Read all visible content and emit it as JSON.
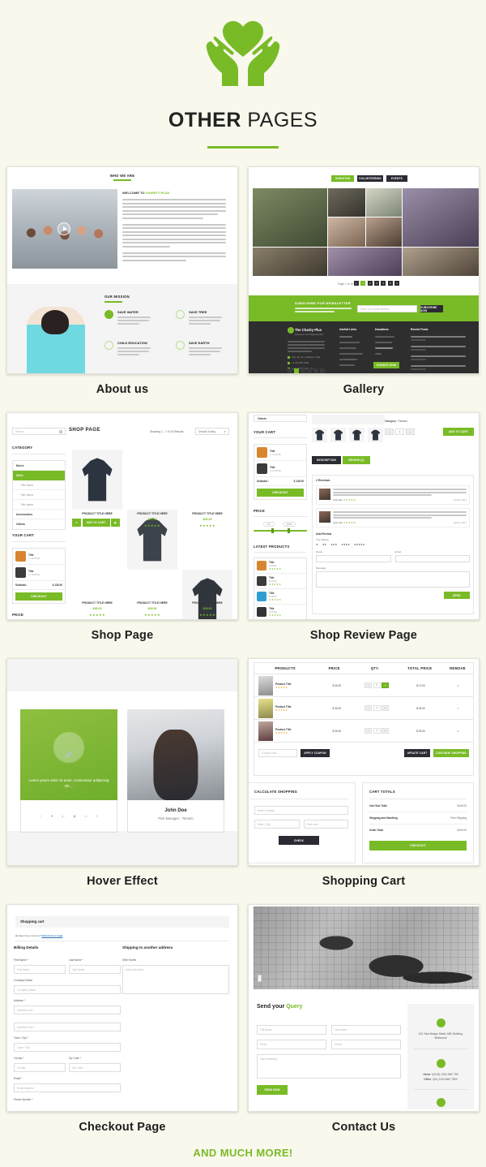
{
  "header": {
    "logo_icon": "heart-in-hands-icon",
    "title_bold": "OTHER",
    "title_light": " PAGES",
    "accent_color": "#79bb27",
    "background_color": "#f9f8ec"
  },
  "footer_note": "AND MUCH MORE!",
  "pages": [
    {
      "id": "about-us",
      "caption": "About us",
      "content": {
        "section1_title": "WHO WE ARE",
        "welcome_prefix": "WELCOME TO ",
        "welcome_brand": "CHARITY PLUS",
        "paragraphs": [
          "Aliquam volutpat malesuada aliquet. Cras sit amet dolor maximus, auctor augue eu, vulputate massa. Praesent ut ligula quis tellus ultrices consequat ut et magna. Nunc imperdiet arcu non dui semper, a elementum nisi pharetra. Donec nec eros eu odio venenatis maximus eros at felis rutrum, a rhoncus est venenatis.",
          "Vivamus ultrices rhoncus ex eget cursus magna pharetra at. Proin molestie mattis mauris, sed vulputate odio facilisis sed. Cras congue odio at ornare pulvinar tempus. Duis malesuada dui vitae tellus mollis vehicula. Sed aliquam molestie libero eget auctor. Integer ut mauris at enim sodales iaculis. Cras tincidunt facilisis lectus eget vulputate. Vestibulum cursus euismod posuere. Mauris sed ornare augue, quis accumsan lacus.",
          "Praesent ullamcorper semper arcu, non tincidunt sapien varius a, vestibulum varius libero nibh, pretium tempor lacus auctor quis. Sed pharetra faucibus ultrices."
        ],
        "section2_title": "OUR MISSION",
        "features": [
          {
            "icon": "water-drop-icon",
            "title": "SAVE WATER",
            "text": "Vestibulum in erat nec ante interdum viverra a a Sed hendrerit, metus"
          },
          {
            "icon": "tree-icon",
            "title": "SAVE TREE",
            "text": "Vestibulum in erat nec ante interdum viverra a a Sed hendrerit, metus"
          },
          {
            "icon": "education-icon",
            "title": "CHILD EDUCATION",
            "text": "Vestibulum in erat nec ante interdum viverra a a Sed hendrerit, metus"
          },
          {
            "icon": "recycle-earth-icon",
            "title": "SAVE EARTH",
            "text": "Vestibulum in erat nec ante interdum viverra a a Sed hendrerit, metus"
          }
        ],
        "play_icon": "play-button-icon"
      }
    },
    {
      "id": "gallery",
      "caption": "Gallery",
      "content": {
        "filters": [
          "DONATION",
          "VOLUNTEERING",
          "EVENTS"
        ],
        "active_filter": "DONATION",
        "pager_label": "Page 1 to 10",
        "pager_items": [
          "«",
          "1",
          "2",
          "3",
          "4",
          "5",
          "6",
          "»"
        ],
        "pager_active": "1",
        "newsletter_title": "SUBSCRIBE FOR NEWSLETTER",
        "newsletter_text": "Lorem ipsum dolor sit amet, consectetur adipiscing elit. Nunc lacinia lorem augue, ut dapibus quam finibus eget.",
        "newsletter_placeholder": "Enter your email address",
        "newsletter_button": "SUBSCRIBE NOW",
        "footer_brand": "The Charity Plus",
        "footer_tagline": "Helping Is Our Daily Routine",
        "footer_about": "Lorem ipsum dolor sit amet, consectetur adipiscing elit. Nam est sit lorem congue at dapibus quam finibus eget. Donec viverra aliquet at.",
        "footer_contacts": [
          "123, abc str, Ludhiana, India",
          "+1 222 854 7000",
          "example@gmail.com"
        ],
        "footer_columns": [
          {
            "title": "Usefull Links",
            "items": [
              "About us",
              "Meet The Team",
              "Volunteers",
              "Service Provided",
              "Latest News",
              "Contact Us"
            ]
          },
          {
            "title": "Donations",
            "items": [
              "How To Donate",
              "Donation List",
              "Recent Causes",
              "FAQ"
            ]
          },
          {
            "title": "Recent Posts",
            "items": [
              "Naturally we regard your statement?",
              "Naturally we regard your statement?",
              "Naturally we regard your statement?",
              "Naturally we regard your statement?"
            ]
          }
        ],
        "donate_button": "DONATE NOW",
        "social_icons": [
          "facebook-icon",
          "twitter-icon",
          "google-plus-icon",
          "instagram-icon",
          "linkedin-icon",
          "skype-icon"
        ]
      }
    },
    {
      "id": "shop-page",
      "caption": "Shop Page",
      "content": {
        "search_placeholder": "Search",
        "search_icon": "search-icon",
        "page_heading": "SHOP PAGE",
        "results_text": "Showing 1 - 7 of 24 Results",
        "sorting_value": "Default Sorting",
        "category_title": "CATEGORY",
        "categories": [
          "Men's",
          "Girl's",
          "Title Name",
          "Title Name",
          "Title Name",
          "Accessories",
          "Others"
        ],
        "active_category": "Girl's",
        "cart_title": "YOUR CART",
        "cart_items": [
          {
            "name": "Title",
            "qty": "1 x $ 45.00",
            "thumb_icon": "watch-icon"
          },
          {
            "name": "Title",
            "qty": "2 x $ 45.00",
            "thumb_icon": "sunglasses-icon"
          }
        ],
        "subtotal_label": "Subtotal :",
        "subtotal_value": "$ 135.00",
        "checkout_button": "CHECKOUT",
        "price_title": "PRICE",
        "products": [
          {
            "title": "PRODUCT TITLE HERE",
            "price": "$45.00",
            "rating": 5,
            "image": "hoodie-black"
          },
          {
            "title": "PRODUCT TITLE HERE",
            "price": "$45.00",
            "rating": 5,
            "image": "hoodie-grey"
          },
          {
            "title": "PRODUCT TITLE HERE",
            "price": "$45.00",
            "rating": 5,
            "image": "hoodie-dark"
          },
          {
            "title": "PRODUCT TITLE HERE",
            "price": "$45.00",
            "rating": 5,
            "image": "jeans-blue"
          },
          {
            "title": "PRODUCT TITLE HERE",
            "price": "$45.00",
            "rating": 5,
            "image": "shirt-lightblue"
          },
          {
            "title": "PRODUCT TITLE HERE",
            "price": "$45.00",
            "rating": 5,
            "image": "shirt-denim"
          }
        ],
        "hover_actions": [
          "wishlist-icon",
          "ADD TO CART",
          "quickview-icon"
        ]
      }
    },
    {
      "id": "shop-review-page",
      "caption": "Shop Review Page",
      "content": {
        "sidebar_top_item": "Others",
        "cart_title": "YOUR CART",
        "cart_items": [
          {
            "name": "Title",
            "qty": "1 x $ 45.00"
          },
          {
            "name": "Title",
            "qty": "2 x $ 45.00"
          }
        ],
        "subtotal_label": "Subtotal :",
        "subtotal_value": "$ 135.00",
        "checkout_button": "CHECKOUT",
        "price_title": "PRICE",
        "price_min": "$ 0",
        "price_max": "$ 500",
        "latest_title": "LATEST PRODUCTS",
        "latest_items": [
          {
            "name": "Title",
            "price": "$ 45.00",
            "rating": 5
          },
          {
            "name": "Title",
            "price": "$ 45.00",
            "rating": 5
          },
          {
            "name": "Title",
            "price": "$ 45.00",
            "rating": 5
          },
          {
            "name": "Title",
            "price": "$ 45.00",
            "rating": 5
          }
        ],
        "category_label": "Category :",
        "category_value": "Fashion",
        "qty_value": "1",
        "add_to_cart_button": "ADD TO CART",
        "tabs": [
          "DESCRIPTION",
          "REVIEW (2)"
        ],
        "active_tab": "REVIEW (2)",
        "reviews_heading": "2 Reviews",
        "reviews": [
          {
            "author": "John Doe",
            "rating": 5,
            "date": "April 10, 2017",
            "text": "Lorem ipsum dolor sit amet, consectetur adipiscing elit. Phasellus venenatis ante pretium, viverra mauris ac, imperdiet neque. Sed tellus neque, suscipit sed elementum in, malesuada id metus. Sed et tincidunt lacus. Phasellus id finibus urna. Vivamus vel tincidunt ante, at imperdiet nisl."
          },
          {
            "author": "John Doe",
            "rating": 5,
            "date": "April 10, 2017",
            "text": "Lorem ipsum dolor sit amet, consectetur adipiscing elit. Phasellus venenatis ante pretium, viverra mauris ac, imperdiet neque. Sed tellus neque, suscipit sed elementum in, malesuada id metus. Sed et tincidunt lacus. Phasellus id finibus urna. Vivamus vel tincidunt ante, at imperdiet nisl."
          }
        ],
        "add_review_title": "Add Review",
        "your_rating_label": "Your Rating",
        "name_label": "Name",
        "email_label": "Email",
        "message_label": "Message",
        "send_button": "SEND"
      }
    },
    {
      "id": "hover-effect",
      "caption": "Hover Effect",
      "content": {
        "hover_text": "Lorem ipsum dolor sit amet, consectetur adipiscing elit....",
        "link_icon": "chain-link-icon",
        "social_icons": [
          "facebook-icon",
          "twitter-icon",
          "google-plus-icon",
          "instagram-icon",
          "linkedin-icon",
          "skype-icon"
        ],
        "person_name": "John Doe",
        "person_role": "Pink Manager - Toronto"
      }
    },
    {
      "id": "shopping-cart",
      "caption": "Shopping Cart",
      "content": {
        "columns": [
          "PRODUCTS",
          "PRICE",
          "QTY.",
          "TOTAL PRICE",
          "REMOVE"
        ],
        "rows": [
          {
            "name": "Product Title",
            "rating": 5,
            "price": "$ 35.00",
            "qty": "2",
            "total": "$ 70.00",
            "remove": "x"
          },
          {
            "name": "Product Title",
            "rating": 5,
            "price": "$ 35.00",
            "qty": "1",
            "total": "$ 35.00",
            "remove": "x"
          },
          {
            "name": "Product Title",
            "rating": 5,
            "price": "$ 35.00",
            "qty": "1",
            "total": "$ 35.00",
            "remove": "x"
          }
        ],
        "coupon_placeholder": "Coupon code",
        "apply_coupon_button": "APPLY COUPON",
        "update_cart_button": "UPDATE CART",
        "continue_shopping_button": "CONTINUE SHOPPING",
        "calc_title": "CALCULATE SHOPPING",
        "country_placeholder": "Select Country",
        "state_placeholder": "State / City",
        "post_placeholder": "Post code",
        "check_button": "CHECK",
        "totals_title": "CART TOTALS",
        "totals": [
          {
            "label": "Cart Sub Total",
            "value": "$140.00"
          },
          {
            "label": "Shipping and Handling",
            "value": "Free Shipping"
          },
          {
            "label": "Order Total",
            "value": "$140.00"
          }
        ],
        "checkout_button": "CHECKOUT"
      }
    },
    {
      "id": "checkout-page",
      "caption": "Checkout Page",
      "content": {
        "banner_title": "Shopping cart",
        "returning_text": "Returning customer? ",
        "returning_link": "Click here to login",
        "billing_title": "Billing Details",
        "shipping_title": "Shipping to another address",
        "fields": [
          {
            "label": "First  Name *",
            "placeholder": "First Name"
          },
          {
            "label": "Last Name *",
            "placeholder": "Last Name"
          },
          {
            "label": "Company Name",
            "placeholder": "Company Name"
          },
          {
            "label": "Address *",
            "placeholder": "Address Line 1"
          },
          {
            "label": "",
            "placeholder": "Address Line 2"
          },
          {
            "label": "Town / City *",
            "placeholder": "Town / City"
          },
          {
            "label": "County *",
            "placeholder": "County"
          },
          {
            "label": "Zip Code *",
            "placeholder": "Zip Code"
          },
          {
            "label": "Email *",
            "placeholder": "Email Address"
          },
          {
            "label": "Phone Number *",
            "placeholder": "Phone Number"
          }
        ],
        "other_notes_label": "Other Notes",
        "other_notes_placeholder": "Add extra notes"
      }
    },
    {
      "id": "contact-us",
      "caption": "Contact Us",
      "content": {
        "map_icon": "map-view",
        "heading_prefix": "Send your ",
        "heading_accent": "Query",
        "fields": [
          {
            "placeholder": "Full Name"
          },
          {
            "placeholder": "Last Name"
          },
          {
            "placeholder": "Email"
          },
          {
            "placeholder": "Phone"
          }
        ],
        "message_placeholder": "Say something",
        "send_button": "SEND  NOW",
        "info": [
          {
            "icon": "location-pin-icon",
            "text": "123, New Design Street, ABC Building, Melbourne"
          },
          {
            "icon": "phone-icon",
            "label1": "Home",
            "value1": "+(0123) 1234 4567 789",
            "label2": "Office",
            "value2": "+(91) 1234 4567 7890"
          },
          {
            "icon": "envelope-icon",
            "text": ""
          }
        ]
      }
    }
  ]
}
